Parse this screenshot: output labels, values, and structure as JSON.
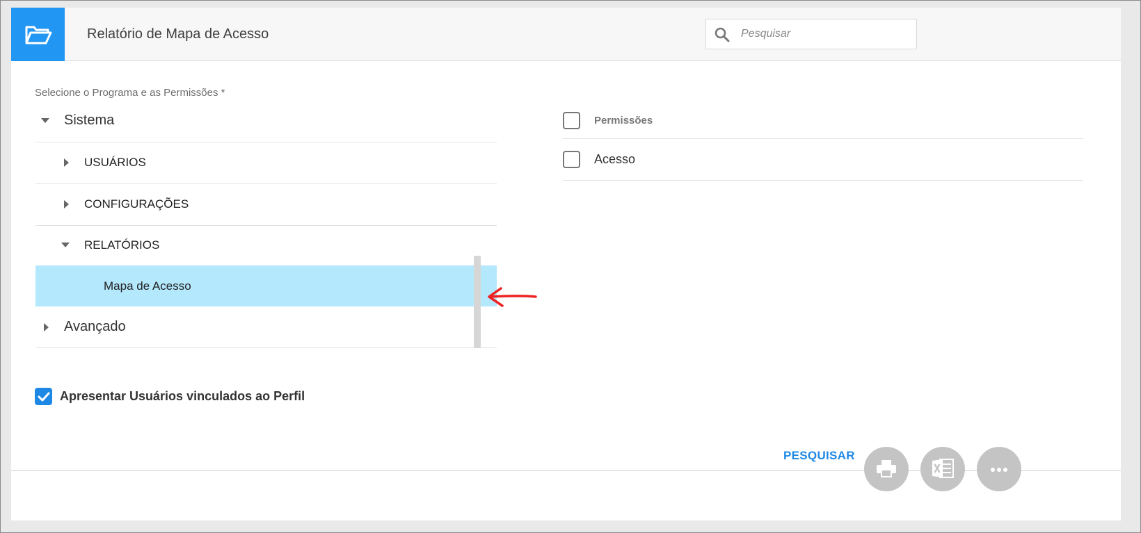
{
  "header": {
    "title": "Relatório de Mapa de Acesso",
    "search_placeholder": "Pesquisar",
    "icons": {
      "folder": "folder-open-icon",
      "search": "search-icon"
    },
    "accent_color": "#2196f3"
  },
  "program_selector": {
    "label": "Selecione o Programa e as Permissões *",
    "tree": [
      {
        "label": "Sistema",
        "level": 0,
        "expanded": true
      },
      {
        "label": "USUÁRIOS",
        "level": 1,
        "expanded": false
      },
      {
        "label": "CONFIGURAÇÕES",
        "level": 1,
        "expanded": false
      },
      {
        "label": "RELATÓRIOS",
        "level": 1,
        "expanded": true
      },
      {
        "label": "Mapa de Acesso",
        "level": 2,
        "selected": true
      },
      {
        "label": "Avançado",
        "level": 0,
        "expanded": false
      }
    ],
    "selected_color": "#b3e8fd"
  },
  "permissions": {
    "header": "Permissões",
    "items": [
      {
        "label": "Acesso",
        "checked": false
      }
    ]
  },
  "options": {
    "show_users_label": "Apresentar Usuários vinculados ao Perfil",
    "show_users_checked": true
  },
  "actions": {
    "search_label": "PESQUISAR",
    "icons": [
      "print-icon",
      "excel-icon",
      "more-icon"
    ]
  }
}
